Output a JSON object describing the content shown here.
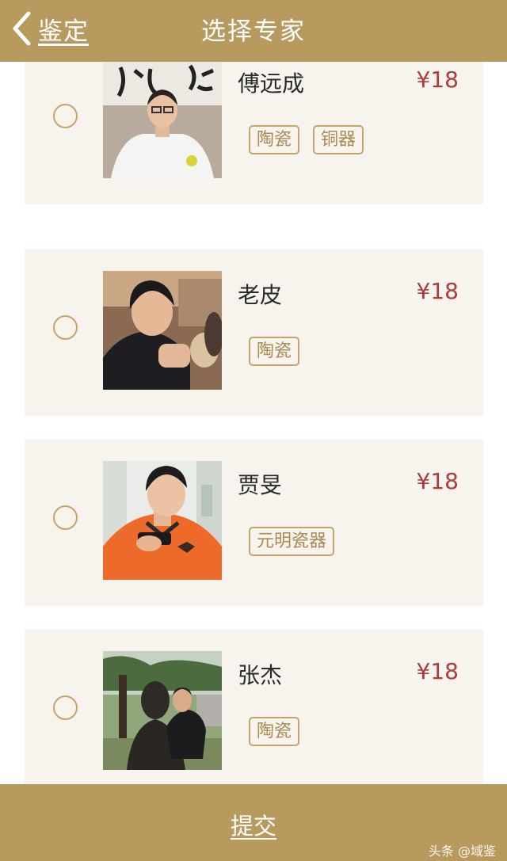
{
  "header": {
    "back_label": "鉴定",
    "title": "选择专家"
  },
  "experts": [
    {
      "name": "傅远成",
      "price": "¥18",
      "tags": [
        "陶瓷",
        "铜器"
      ],
      "selected": false
    },
    {
      "name": "老皮",
      "price": "¥18",
      "tags": [
        "陶瓷"
      ],
      "selected": false
    },
    {
      "name": "贾旻",
      "price": "¥18",
      "tags": [
        "元明瓷器"
      ],
      "selected": false
    },
    {
      "name": "张杰",
      "price": "¥18",
      "tags": [
        "陶瓷"
      ],
      "selected": false
    }
  ],
  "footer": {
    "submit_label": "提交",
    "watermark": "头条 @域鉴"
  },
  "colors": {
    "brand": "#b89a5f",
    "price": "#b0393b",
    "tag_border": "#c7a56a",
    "card_bg": "#f7f3ed"
  }
}
